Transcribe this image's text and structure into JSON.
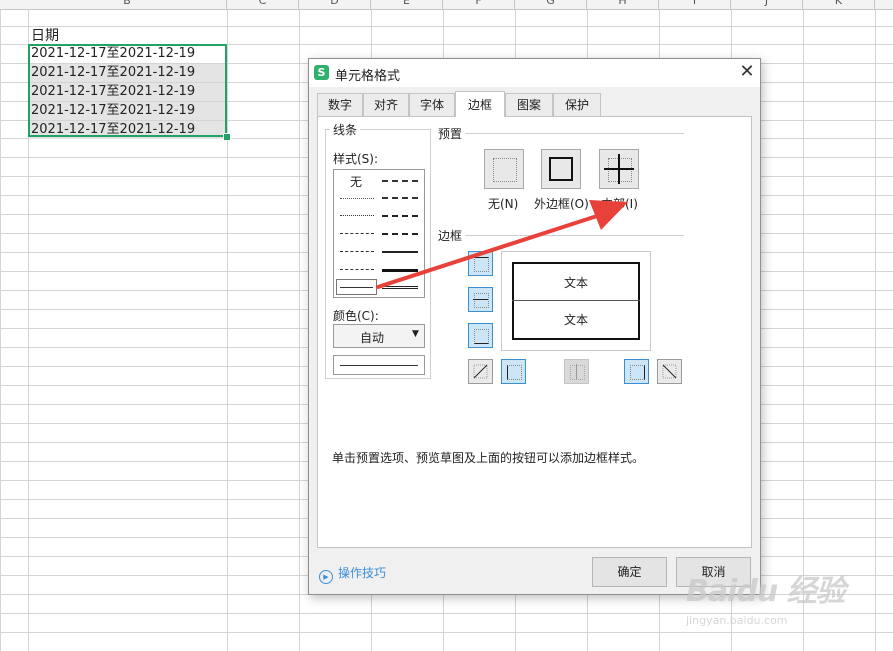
{
  "sheet": {
    "columns": [
      "B",
      "C",
      "D",
      "E",
      "F",
      "G",
      "H",
      "I",
      "J",
      "K"
    ],
    "header_cell": "日期",
    "rows": [
      "2021-12-17至2021-12-19",
      "2021-12-17至2021-12-19",
      "2021-12-17至2021-12-19",
      "2021-12-17至2021-12-19",
      "2021-12-17至2021-12-19"
    ]
  },
  "dialog": {
    "title": "单元格格式",
    "app_icon": "S",
    "tabs": [
      "数字",
      "对齐",
      "字体",
      "边框",
      "图案",
      "保护"
    ],
    "active_tab": "边框",
    "line_group": "线条",
    "style_label": "样式(S):",
    "style_none": "无",
    "color_label": "颜色(C):",
    "color_value": "自动",
    "preset_group": "预置",
    "preset_none": "无(N)",
    "preset_outline": "外边框(O)",
    "preset_inside": "内部(I)",
    "border_group": "边框",
    "preview_text_top": "文本",
    "preview_text_bottom": "文本",
    "hint": "单击预置选项、预览草图及上面的按钮可以添加边框样式。",
    "tips_link": "操作技巧",
    "ok": "确定",
    "cancel": "取消"
  },
  "watermark": {
    "main": "Baidu 经验",
    "sub": "jingyan.baidu.com"
  },
  "colors": {
    "selection": "#21a366",
    "annotation_arrow": "#e8413a",
    "active_toggle": "#cde6f7",
    "link": "#3c8fd6"
  }
}
